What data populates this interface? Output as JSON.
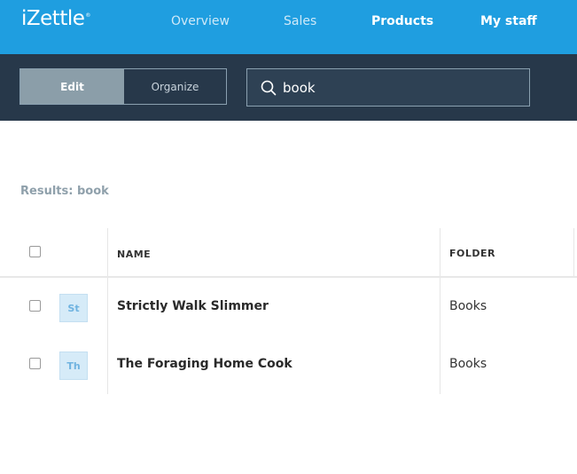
{
  "header": {
    "logo": "iZettle",
    "logo_mark": "®",
    "nav": [
      {
        "label": "Overview",
        "active": false
      },
      {
        "label": "Sales",
        "active": false
      },
      {
        "label": "Products",
        "active": true
      },
      {
        "label": "My staff",
        "active": true
      }
    ]
  },
  "toolbar": {
    "edit_label": "Edit",
    "organize_label": "Organize",
    "search_value": "book"
  },
  "results": {
    "label": "Results: book"
  },
  "table": {
    "columns": {
      "name": "NAME",
      "folder": "FOLDER"
    },
    "rows": [
      {
        "thumb": "St",
        "name": "Strictly Walk Slimmer",
        "folder": "Books"
      },
      {
        "thumb": "Th",
        "name": "The Foraging Home Cook",
        "folder": "Books"
      }
    ]
  },
  "colors": {
    "header_bg": "#1f9ee0",
    "toolbar_bg": "#27384a",
    "active_segment": "#8b9ea9",
    "thumb_bg": "#d6ebf8"
  }
}
